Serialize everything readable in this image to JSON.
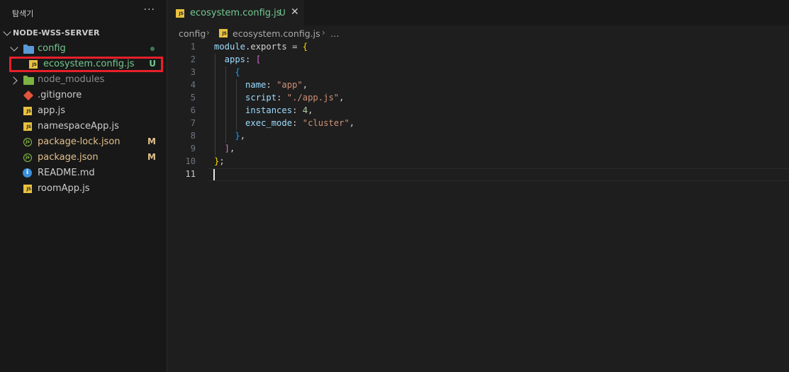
{
  "sidebar": {
    "title": "탐색기",
    "more_label": "···",
    "project": "NODE-WSS-SERVER",
    "items": [
      {
        "label": "config",
        "status": "",
        "kind": "folder"
      },
      {
        "label": "ecosystem.config.js",
        "status": "U",
        "kind": "js"
      },
      {
        "label": "node_modules",
        "status": "",
        "kind": "folder"
      },
      {
        "label": ".gitignore",
        "status": "",
        "kind": "git"
      },
      {
        "label": "app.js",
        "status": "",
        "kind": "js"
      },
      {
        "label": "namespaceApp.js",
        "status": "",
        "kind": "js"
      },
      {
        "label": "package-lock.json",
        "status": "M",
        "kind": "json"
      },
      {
        "label": "package.json",
        "status": "M",
        "kind": "json"
      },
      {
        "label": "README.md",
        "status": "",
        "kind": "info"
      },
      {
        "label": "roomApp.js",
        "status": "",
        "kind": "js"
      }
    ]
  },
  "tab": {
    "label": "ecosystem.config.js",
    "status": "U",
    "close": "✕"
  },
  "breadcrumb": {
    "folder": "config",
    "file": "ecosystem.config.js",
    "more": "…"
  },
  "editor": {
    "line_numbers": [
      "1",
      "2",
      "3",
      "4",
      "5",
      "6",
      "7",
      "8",
      "9",
      "10",
      "11"
    ],
    "active_line": "11",
    "code": {
      "l1_a": "module",
      "l1_b": ".exports = ",
      "l1_c": "{",
      "l2_a": "  apps",
      "l2_b": ": ",
      "l2_c": "[",
      "l3": "    {",
      "l4_a": "      name",
      "l4_b": ": ",
      "l4_c": "\"app\"",
      "l4_d": ",",
      "l5_a": "      script",
      "l5_b": ": ",
      "l5_c": "\"./app.js\"",
      "l5_d": ",",
      "l6_a": "      instances",
      "l6_b": ": ",
      "l6_c": "4",
      "l6_d": ",",
      "l7_a": "      exec_mode",
      "l7_b": ": ",
      "l7_c": "\"cluster\"",
      "l7_d": ",",
      "l8_a": "    }",
      "l8_b": ",",
      "l9_a": "  ]",
      "l9_b": ",",
      "l10_a": "}",
      "l10_b": ";"
    }
  },
  "colors": {
    "git_untracked": "#73c991",
    "git_modified": "#e2c08d",
    "highlight_box": "#e8202a"
  }
}
